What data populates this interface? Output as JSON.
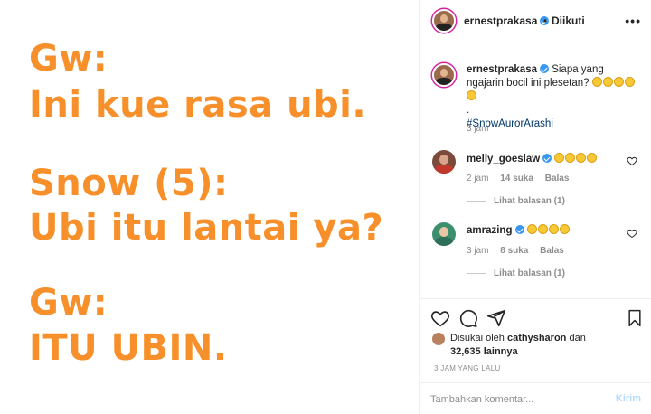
{
  "post_image": {
    "lines": [
      "Gw:",
      "Ini kue rasa ubi.",
      "Snow (5):",
      "Ubi itu lantai ya?",
      "Gw:",
      "ITU UBIN."
    ],
    "text_color": "#f7902a"
  },
  "header": {
    "username": "ernestprakasa",
    "separator": "•",
    "follow_state": "Diikuti",
    "more_label": "•••"
  },
  "caption": {
    "username": "ernestprakasa",
    "text": "Siapa yang ngajarin bocil ini plesetan?",
    "emoji_count": 5,
    "dot": ".",
    "hashtag": "#SnowAurorArashi",
    "time": "3 jam"
  },
  "comments": [
    {
      "username": "melly_goeslaw",
      "emoji_count": 4,
      "time": "2 jam",
      "likes": "14 suka",
      "reply": "Balas",
      "view_replies": "Lihat balasan (1)"
    },
    {
      "username": "amrazing",
      "emoji_count": 4,
      "time": "3 jam",
      "likes": "8 suka",
      "reply": "Balas",
      "view_replies": "Lihat balasan (1)"
    }
  ],
  "actions": {
    "liked_by_prefix": "Disukai oleh",
    "liked_by_user": "cathysharon",
    "liked_by_and": "dan",
    "others_count": "32,635",
    "others_label": "lainnya",
    "posted_ago": "3 JAM YANG LALU",
    "comment_placeholder": "Tambahkan komentar...",
    "post_label": "Kirim"
  },
  "colors": {
    "verified": "#3897f0",
    "hashtag": "#00376b",
    "muted": "#8e8e8e",
    "post_disabled": "#b3dbff"
  }
}
